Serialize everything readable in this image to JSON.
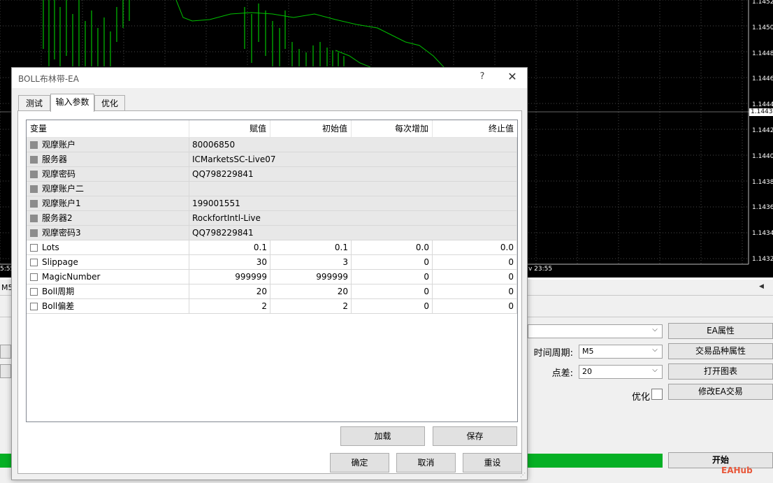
{
  "chart": {
    "price_levels": [
      "1.14520",
      "1.14500",
      "1.14480",
      "1.14460",
      "1.14440",
      "1.14420",
      "1.14400",
      "1.14380",
      "1.14360",
      "1.14340",
      "1.14320"
    ],
    "current_price": "1.14430",
    "time_left": "5:55",
    "time_right": "v 23:55",
    "colors": {
      "background": "#000000",
      "bars": "#00c000",
      "band": "#00c000",
      "current_line": "#ffffff"
    }
  },
  "strip": {
    "left_text": "M5"
  },
  "tester": {
    "period_label": "时间周期:",
    "period_value": "M5",
    "spread_label": "点差:",
    "spread_value": "20",
    "optimize_label": "优化",
    "buttons": {
      "ea_props": "EA属性",
      "symbol_props": "交易品种属性",
      "open_chart": "打开图表",
      "modify_ea": "修改EA交易",
      "start": "开始"
    },
    "progress_color": "#06b025",
    "watermark": "EAHub"
  },
  "dialog": {
    "title": "BOLL布林带-EA",
    "help": "?",
    "close": "✕",
    "tabs": [
      "测试",
      "输入参数",
      "优化"
    ],
    "active_tab": 1,
    "columns": [
      "变量",
      "赋值",
      "初始值",
      "每次增加",
      "终止值"
    ],
    "rows": [
      {
        "name": "观摩账户",
        "value": "80006850",
        "start": "",
        "step": "",
        "stop": "",
        "type": "string"
      },
      {
        "name": "服务器",
        "value": "ICMarketsSC-Live07",
        "start": "",
        "step": "",
        "stop": "",
        "type": "string"
      },
      {
        "name": "观摩密码",
        "value": "QQ798229841",
        "start": "",
        "step": "",
        "stop": "",
        "type": "string"
      },
      {
        "name": "观摩账户二",
        "value": "",
        "start": "",
        "step": "",
        "stop": "",
        "type": "string"
      },
      {
        "name": "观摩账户1",
        "value": "199001551",
        "start": "",
        "step": "",
        "stop": "",
        "type": "string"
      },
      {
        "name": "服务器2",
        "value": "RockfortIntl-Live",
        "start": "",
        "step": "",
        "stop": "",
        "type": "string"
      },
      {
        "name": "观摩密码3",
        "value": "QQ798229841",
        "start": "",
        "step": "",
        "stop": "",
        "type": "string"
      },
      {
        "name": "Lots",
        "value": "0.1",
        "start": "0.1",
        "step": "0.0",
        "stop": "0.0",
        "type": "number"
      },
      {
        "name": "Slippage",
        "value": "30",
        "start": "3",
        "step": "0",
        "stop": "0",
        "type": "number"
      },
      {
        "name": "MagicNumber",
        "value": "999999",
        "start": "999999",
        "step": "0",
        "stop": "0",
        "type": "number"
      },
      {
        "name": "Boll周期",
        "value": "20",
        "start": "20",
        "step": "0",
        "stop": "0",
        "type": "number"
      },
      {
        "name": "Boll偏差",
        "value": "2",
        "start": "2",
        "step": "0",
        "stop": "0",
        "type": "number"
      }
    ],
    "buttons": {
      "load": "加载",
      "save": "保存",
      "ok": "确定",
      "cancel": "取消",
      "reset": "重设"
    }
  }
}
